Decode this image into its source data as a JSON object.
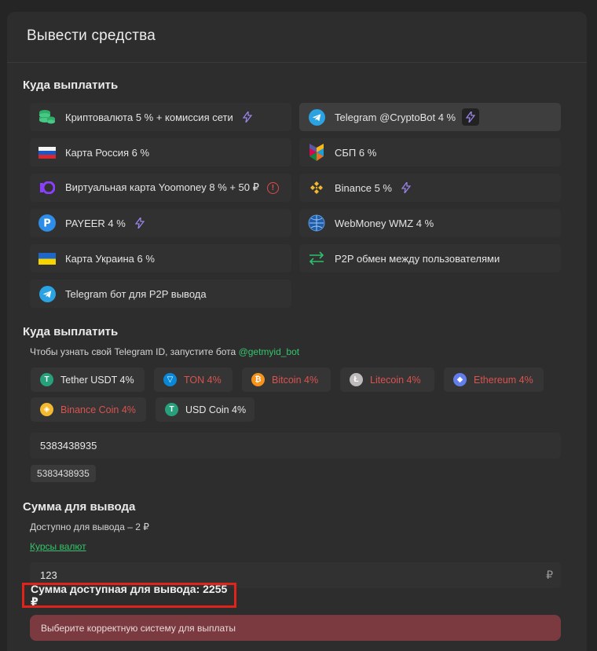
{
  "panel": {
    "title": "Вывести средства"
  },
  "sections": {
    "where": "Куда выплатить",
    "where2": "Куда выплатить",
    "amount": "Сумма для вывода"
  },
  "methods": [
    {
      "label": "Криптовалюта 5 % + комиссия сети",
      "icon": "coins-stack-icon",
      "extra": "bolt"
    },
    {
      "label": "Telegram @CryptoBot 4 %",
      "icon": "telegram-icon",
      "extra": "bolt-box",
      "selected": true
    },
    {
      "label": "Карта Россия 6 %",
      "icon": "russia-flag-icon"
    },
    {
      "label": "СБП 6 %",
      "icon": "sbp-icon"
    },
    {
      "label": "Виртуальная карта Yoomoney 8 % + 50 ₽",
      "icon": "yoomoney-icon",
      "extra": "warn"
    },
    {
      "label": "Binance 5 %",
      "icon": "binance-icon",
      "extra": "bolt"
    },
    {
      "label": "PAYEER 4 %",
      "icon": "payeer-icon",
      "extra": "bolt"
    },
    {
      "label": "WebMoney WMZ 4 %",
      "icon": "webmoney-icon"
    },
    {
      "label": "Карта Украина 6 %",
      "icon": "ukraine-flag-icon"
    },
    {
      "label": "P2P обмен между пользователями",
      "icon": "exchange-arrows-icon"
    },
    {
      "label": "Telegram бот для P2P вывода",
      "icon": "telegram-icon"
    }
  ],
  "hint": {
    "text": "Чтобы узнать свой Telegram ID, запустите бота ",
    "link": "@getmyid_bot"
  },
  "coins": [
    {
      "label": "Tether USDT 4%",
      "color": "#26a17b",
      "state": "ok"
    },
    {
      "label": "TON 4%",
      "color": "#0a88d8",
      "state": "bad"
    },
    {
      "label": "Bitcoin 4%",
      "color": "#f7931a",
      "state": "bad"
    },
    {
      "label": "Litecoin 4%",
      "color": "#bfbbbb",
      "state": "bad"
    },
    {
      "label": "Ethereum 4%",
      "color": "#627eea",
      "state": "bad"
    },
    {
      "label": "Binance Coin 4%",
      "color": "#f3ba2f",
      "state": "bad"
    },
    {
      "label": "USD Coin 4%",
      "color": "#26a17b",
      "state": "ok"
    }
  ],
  "telegram_id": {
    "value": "5383438935",
    "chip": "5383438935"
  },
  "amount": {
    "available": "Доступно для вывода – 2 ₽",
    "rates_link": "Курсы валют",
    "value": "123",
    "currency": "₽",
    "total": "Сумма доступная для вывода: 2255 ₽"
  },
  "error": "Выберите корректную систему для выплаты"
}
